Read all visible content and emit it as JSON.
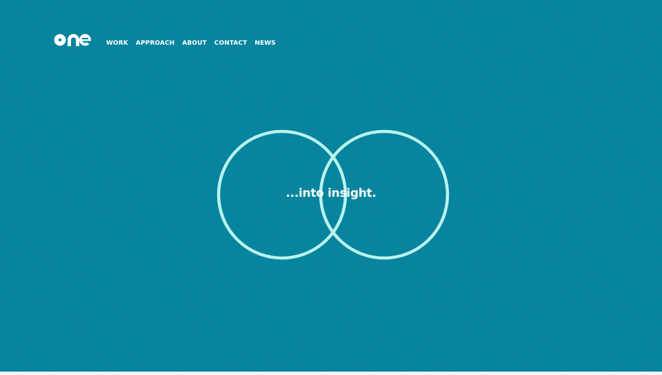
{
  "header": {
    "logo_text": "one",
    "nav": [
      {
        "label": "WORK"
      },
      {
        "label": "APPROACH"
      },
      {
        "label": "ABOUT"
      },
      {
        "label": "CONTACT"
      },
      {
        "label": "NEWS"
      }
    ]
  },
  "hero": {
    "tagline": "...into insight."
  },
  "colors": {
    "background": "#06849e",
    "circle_stroke": "#b8f4ee",
    "text": "#ffffff"
  }
}
